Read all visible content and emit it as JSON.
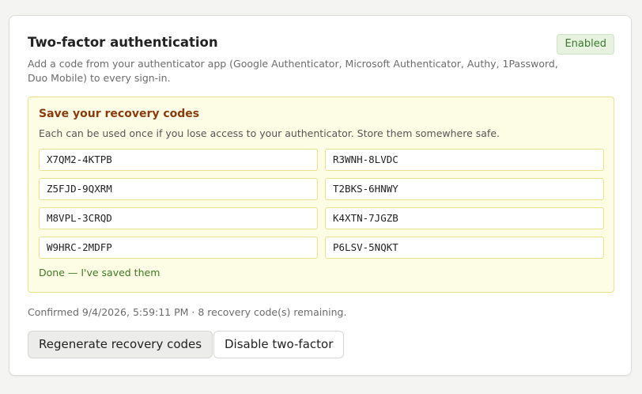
{
  "header": {
    "title": "Two-factor authentication",
    "status_badge": "Enabled",
    "description": "Add a code from your authenticator app (Google Authenticator, Microsoft Authenticator, Authy, 1Password, Duo Mobile) to every sign-in."
  },
  "recovery": {
    "title": "Save your recovery codes",
    "description": "Each can be used once if you lose access to your authenticator. Store them somewhere safe.",
    "codes": [
      "X7QM2-4KTPB",
      "R3WNH-8LVDC",
      "Z5FJD-9QXRM",
      "T2BKS-6HNWY",
      "M8VPL-3CRQD",
      "K4XTN-7JGZB",
      "W9HRC-2MDFP",
      "P6LSV-5NQKT"
    ],
    "done_label": "Done — I've saved them"
  },
  "status_text": "Confirmed 9/4/2026, 5:59:11 PM · 8 recovery code(s) remaining.",
  "actions": {
    "regenerate_label": "Regenerate recovery codes",
    "disable_label": "Disable two-factor"
  },
  "colors": {
    "badge_green": "#3a7a2d",
    "recovery_bg": "#fdfde6",
    "recovery_title": "#8a3b0b",
    "done_link": "#3d7a1e"
  }
}
